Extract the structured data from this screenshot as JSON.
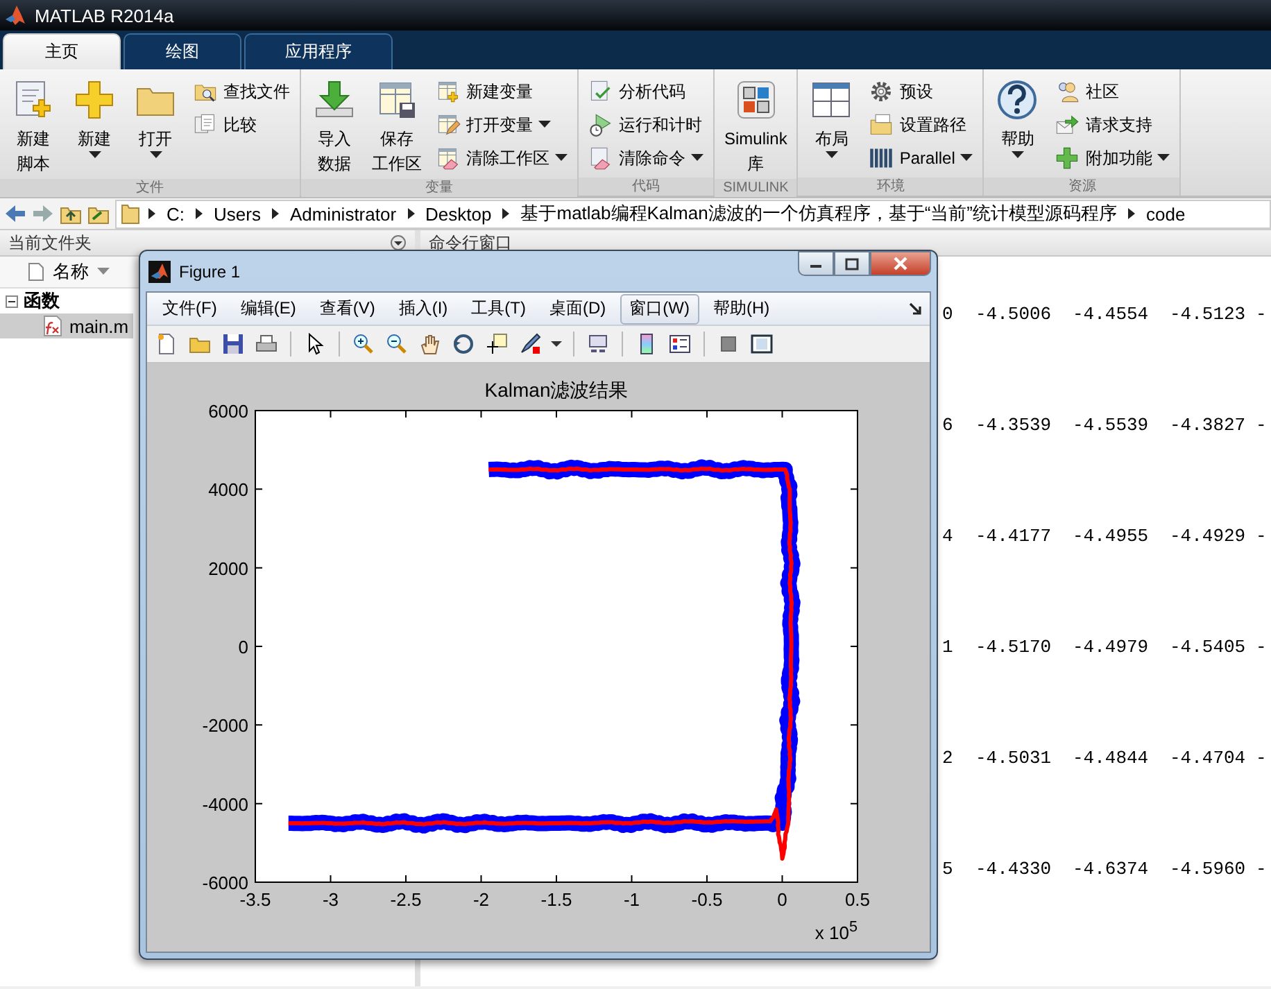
{
  "window": {
    "title": "MATLAB R2014a"
  },
  "tabs": [
    {
      "label": "主页",
      "selected": true
    },
    {
      "label": "绘图",
      "selected": false
    },
    {
      "label": "应用程序",
      "selected": false
    }
  ],
  "ribbon": {
    "groups": [
      {
        "label": "文件",
        "items": [
          {
            "kind": "large",
            "lines": [
              "新建",
              "脚本"
            ],
            "menu": false
          },
          {
            "kind": "large",
            "lines": [
              "新建"
            ],
            "menu": true
          },
          {
            "kind": "large",
            "lines": [
              "打开"
            ],
            "menu": true
          },
          {
            "kind": "column",
            "items": [
              {
                "label": "查找文件",
                "menu": false
              },
              {
                "label": "比较",
                "menu": false
              }
            ]
          }
        ]
      },
      {
        "label": "变量",
        "items": [
          {
            "kind": "large",
            "lines": [
              "导入",
              "数据"
            ],
            "menu": false
          },
          {
            "kind": "large",
            "lines": [
              "保存",
              "工作区"
            ],
            "menu": false
          },
          {
            "kind": "column",
            "items": [
              {
                "label": "新建变量",
                "menu": false
              },
              {
                "label": "打开变量",
                "menu": true
              },
              {
                "label": "清除工作区",
                "menu": true
              }
            ]
          }
        ]
      },
      {
        "label": "代码",
        "items": [
          {
            "kind": "column",
            "items": [
              {
                "label": "分析代码",
                "menu": false
              },
              {
                "label": "运行和计时",
                "menu": false
              },
              {
                "label": "清除命令",
                "menu": true
              }
            ]
          }
        ]
      },
      {
        "label": "SIMULINK",
        "items": [
          {
            "kind": "large",
            "lines": [
              "Simulink",
              "库"
            ],
            "menu": false
          }
        ]
      },
      {
        "label": "环境",
        "items": [
          {
            "kind": "large",
            "lines": [
              "布局"
            ],
            "menu": true
          },
          {
            "kind": "column",
            "items": [
              {
                "label": "预设",
                "menu": false
              },
              {
                "label": "设置路径",
                "menu": false
              },
              {
                "label": "Parallel",
                "menu": true
              }
            ]
          }
        ]
      },
      {
        "label": "资源",
        "items": [
          {
            "kind": "large",
            "lines": [
              "帮助"
            ],
            "menu": true
          },
          {
            "kind": "column",
            "items": [
              {
                "label": "社区",
                "menu": false
              },
              {
                "label": "请求支持",
                "menu": false
              },
              {
                "label": "附加功能",
                "menu": true
              }
            ]
          }
        ]
      }
    ]
  },
  "address_bar": {
    "path": [
      "C:",
      "Users",
      "Administrator",
      "Desktop",
      "基于matlab编程Kalman滤波的一个仿真程序，基于“当前”统计模型源码程序",
      "code"
    ]
  },
  "current_folder": {
    "title": "当前文件夹",
    "column": "名称",
    "tree": [
      {
        "label": "函数",
        "expanded": true,
        "selected": false,
        "children": [
          {
            "label": "main.m",
            "selected": true
          }
        ]
      }
    ]
  },
  "command_window": {
    "title": "命令行窗口",
    "rows": [
      {
        "cells": [
          "0",
          "-4.5006",
          "-4.4554",
          "-4.5123",
          "-"
        ]
      },
      {
        "cells": [
          "6",
          "-4.3539",
          "-4.5539",
          "-4.3827",
          "-"
        ]
      },
      {
        "cells": [
          "4",
          "-4.4177",
          "-4.4955",
          "-4.4929",
          "-"
        ]
      },
      {
        "cells": [
          "1",
          "-4.5170",
          "-4.4979",
          "-4.5405",
          "-"
        ]
      },
      {
        "cells": [
          "2",
          "-4.5031",
          "-4.4844",
          "-4.4704",
          "-"
        ]
      },
      {
        "cells": [
          "5",
          "-4.4330",
          "-4.6374",
          "-4.5960",
          "-"
        ]
      }
    ]
  },
  "figure": {
    "title": "Figure 1",
    "menu": [
      {
        "label": "文件(F)",
        "highlighted": false
      },
      {
        "label": "编辑(E)",
        "highlighted": false
      },
      {
        "label": "查看(V)",
        "highlighted": false
      },
      {
        "label": "插入(I)",
        "highlighted": false
      },
      {
        "label": "工具(T)",
        "highlighted": false
      },
      {
        "label": "桌面(D)",
        "highlighted": false
      },
      {
        "label": "窗口(W)",
        "highlighted": true
      },
      {
        "label": "帮助(H)",
        "highlighted": false
      }
    ],
    "axis_multiplier": "x 10$^{5}$",
    "chart_data": {
      "type": "line",
      "title": "Kalman滤波结果",
      "x": [
        -3.28,
        -1.5,
        -0.08,
        -0.04,
        0.0,
        0.04,
        0.06,
        0.05,
        0.02,
        -1.0,
        -1.95
      ],
      "series": [
        {
          "color": "#0000ff",
          "values": [
            -4500,
            -4500,
            -4500,
            -4500,
            -4500,
            -3000,
            0,
            3500,
            4500,
            4500,
            4500
          ]
        },
        {
          "color": "#ff0000",
          "values": [
            -4500,
            -4500,
            -4450,
            -4150,
            -5400,
            -4500,
            0,
            4000,
            4500,
            4500,
            4500
          ]
        }
      ],
      "xlim": [
        -3.5,
        0.5
      ],
      "ylim": [
        -6000,
        6000
      ],
      "xticks": [
        -3.5,
        -3,
        -2.5,
        -2,
        -1.5,
        -1,
        -0.5,
        0,
        0.5
      ],
      "yticks": [
        -6000,
        -4000,
        -2000,
        0,
        2000,
        4000,
        6000
      ]
    }
  }
}
